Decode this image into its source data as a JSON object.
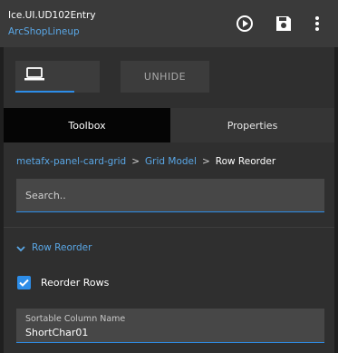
{
  "header": {
    "title": "Ice.UI.UD102Entry",
    "subtitle": "ArcShopLineup",
    "icons": [
      "play-circle-icon",
      "save-icon",
      "more-vertical-icon"
    ]
  },
  "toolbar": {
    "view_icon": "laptop-icon",
    "unhide_label": "UNHIDE"
  },
  "tabs": [
    {
      "label": "Toolbox",
      "active": true
    },
    {
      "label": "Properties",
      "active": false
    }
  ],
  "breadcrumb": {
    "items": [
      "metafx-panel-card-grid",
      "Grid Model",
      "Row Reorder"
    ],
    "separator": ">"
  },
  "search": {
    "placeholder": "Search..",
    "value": ""
  },
  "section": {
    "label": "Row Reorder",
    "expanded": true
  },
  "checkbox": {
    "label": "Reorder Rows",
    "checked": true
  },
  "field": {
    "label": "Sortable Column Name",
    "value": "ShortChar01"
  },
  "colors": {
    "accent": "#2d8de8",
    "link": "#5aa7e6",
    "background": "#2f2f2f",
    "active_tab": "#050505"
  }
}
